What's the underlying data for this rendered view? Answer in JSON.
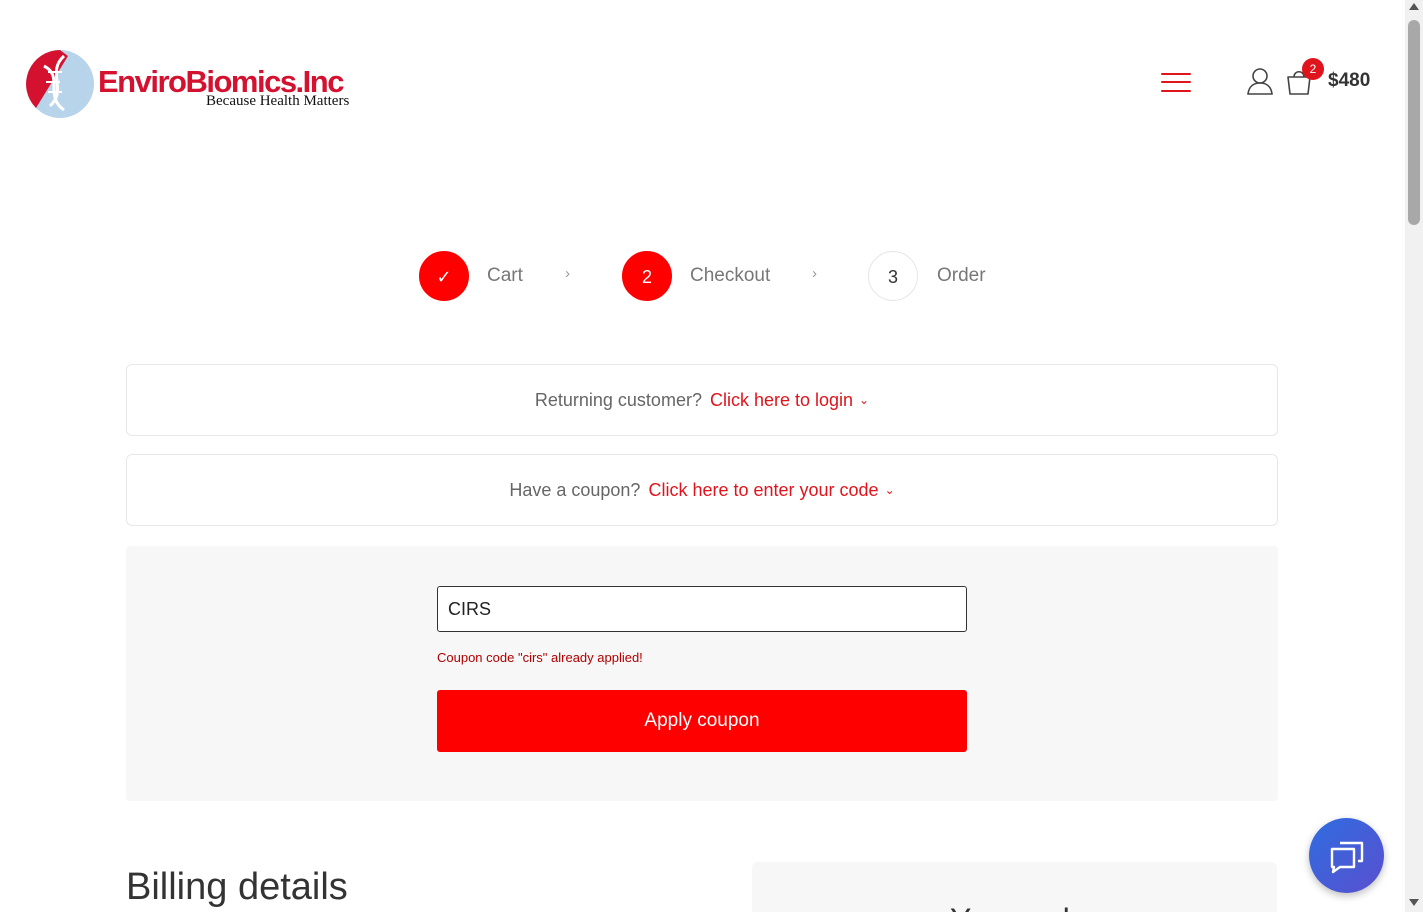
{
  "header": {
    "logo_name": "EnviroBiomics.Inc",
    "logo_tagline": "Because Health Matters",
    "cart_count": "2",
    "cart_total": "$480",
    "menu_icon": "hamburger-menu-icon",
    "user_icon": "user-icon",
    "cart_icon": "shopping-bag-icon"
  },
  "steps": [
    {
      "label": "Cart",
      "marker": "✓",
      "state": "done"
    },
    {
      "label": "Checkout",
      "marker": "2",
      "state": "active"
    },
    {
      "label": "Order",
      "marker": "3",
      "state": "todo"
    }
  ],
  "login_notice": {
    "question": "Returning customer?",
    "link": "Click here to login"
  },
  "coupon_notice": {
    "question": "Have a coupon?",
    "link": "Click here to enter your code"
  },
  "coupon_form": {
    "value": "CIRS",
    "message": "Coupon code \"cirs\" already applied!",
    "button_label": "Apply coupon"
  },
  "billing": {
    "title": "Billing details",
    "order_title": "Your order"
  },
  "colors": {
    "accent": "#ff0000",
    "brand_red": "#d4112f",
    "chat_gradient_start": "#2f6de0",
    "chat_gradient_end": "#5a4fcf"
  }
}
